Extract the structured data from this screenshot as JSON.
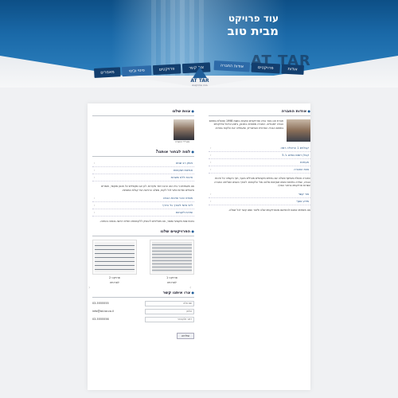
{
  "hero": {
    "title_small": "עוד פרויקט",
    "title_big": "מבית טוב",
    "brand_text": "AT TAR"
  },
  "logo": {
    "name": "AT TAR",
    "tagline": "בניה ופרויקטים"
  },
  "nav_right": [
    "אודות",
    "פרויקטים",
    "אודות החברה"
  ],
  "nav_left": [
    "צור קשר",
    "פרויקטים",
    "פינוי ובינוי",
    "מאמרים"
  ],
  "about": {
    "title": "אודות החברה",
    "text": "חברת אט-טאר בניה ופרויקטים הוקמה בשנת 1998 ופועלת בתחום הבניה למגורים. החברה מתמחה בתכנון, ביצוע וניהול פרויקטים בתחום הבניה הפרטית והציבורית, ומעמידה את הלקוח במרכז.",
    "links": [
      "קבלנים 1 הרצליה רמה",
      "קבלן רשום בסיווג ג'-5",
      "תעודות",
      "צוות החברה"
    ],
    "para1": "החברה פועלת בשיתוף פעולה עם גורמים מקצועיים מובילים בענף, תוך הקפדה על איכות הבניה, עמידה בלוחות זמנים ושקיפות מלאה מול הלקוחות. לאורך השנים השלימה החברה עשרות פרויקטים ברחבי הארץ.",
    "links2": [
      "צור קשר",
      "מידע נוסף"
    ],
    "para2": "אנו מזמינים אתכם להתרשם מהפרויקטים שלנו וליצור עמנו קשר לכל שאלה."
  },
  "ceo": {
    "title": "צוות שלנו",
    "caption": "מנכ\"ל החברה"
  },
  "why": {
    "title": "למה לבחור אותנו?",
    "links": [
      "ניסיון רב שנים",
      "אמינות ושקיפות",
      "איכות ללא פשרות"
    ],
    "para": "אנו מאמינים כי בית הוא הרבה יותר מקירות. לכן אנו מקפידים על תכנון מוקפד, חומרים איכותיים ושירות אישי לכל לקוח, משלב הרכישה ועד קבלת המפתח.",
    "links2": [
      "מפרט טכני ואיכות הבניה",
      "ליווי אישי לאורך כל הדרך",
      "שירות לקוחות"
    ],
    "para2": "בזכות צוות מקצועי ומסור, אנו מצליחים להעניק ללקוחותינו חוויית רכישה בטוחה ונעימה."
  },
  "projects": {
    "title": "הפרויקטים שלנו",
    "items": [
      {
        "caption": "פרויקט 1",
        "sub": "לפרטים"
      },
      {
        "caption": "פרויקט 2",
        "sub": "לפרטים"
      }
    ]
  },
  "contact": {
    "title": "צרו איתנו קשר",
    "phone": "03-5555555",
    "email": "info@at-tar.co.il",
    "fax": "03-5555556",
    "name_placeholder": "שם מלא",
    "phone_placeholder": "טלפון",
    "email_placeholder": "דואר אלקטרוני",
    "send_label": "שליחה"
  }
}
